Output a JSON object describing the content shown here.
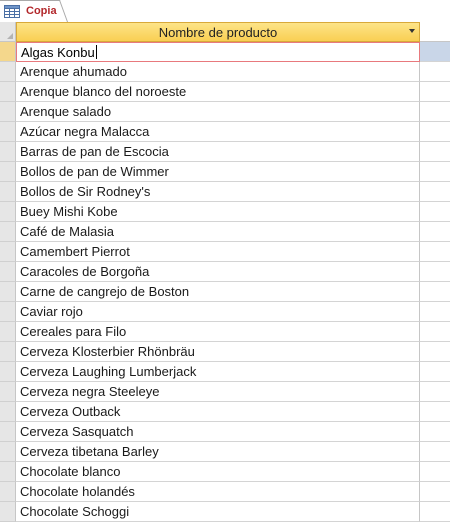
{
  "tab": {
    "label": "Copia",
    "icon": "table-icon",
    "label_color": "#b2272b"
  },
  "column": {
    "header": "Nombre de producto",
    "header_bg": "#f9cf53"
  },
  "rows": [
    "Algas Konbu",
    "Arenque ahumado",
    "Arenque blanco del noroeste",
    "Arenque salado",
    "Azúcar negra Malacca",
    "Barras de pan de Escocia",
    "Bollos de pan de Wimmer",
    "Bollos de Sir Rodney's",
    "Buey Mishi Kobe",
    "Café de Malasia",
    "Camembert Pierrot",
    "Caracoles de Borgoña",
    "Carne de cangrejo de Boston",
    "Caviar rojo",
    "Cereales para Filo",
    "Cerveza Klosterbier Rhönbräu",
    "Cerveza Laughing Lumberjack",
    "Cerveza negra Steeleye",
    "Cerveza Outback",
    "Cerveza Sasquatch",
    "Cerveza tibetana Barley",
    "Chocolate blanco",
    "Chocolate holandés",
    "Chocolate Schoggi"
  ],
  "current_row_index": 0
}
